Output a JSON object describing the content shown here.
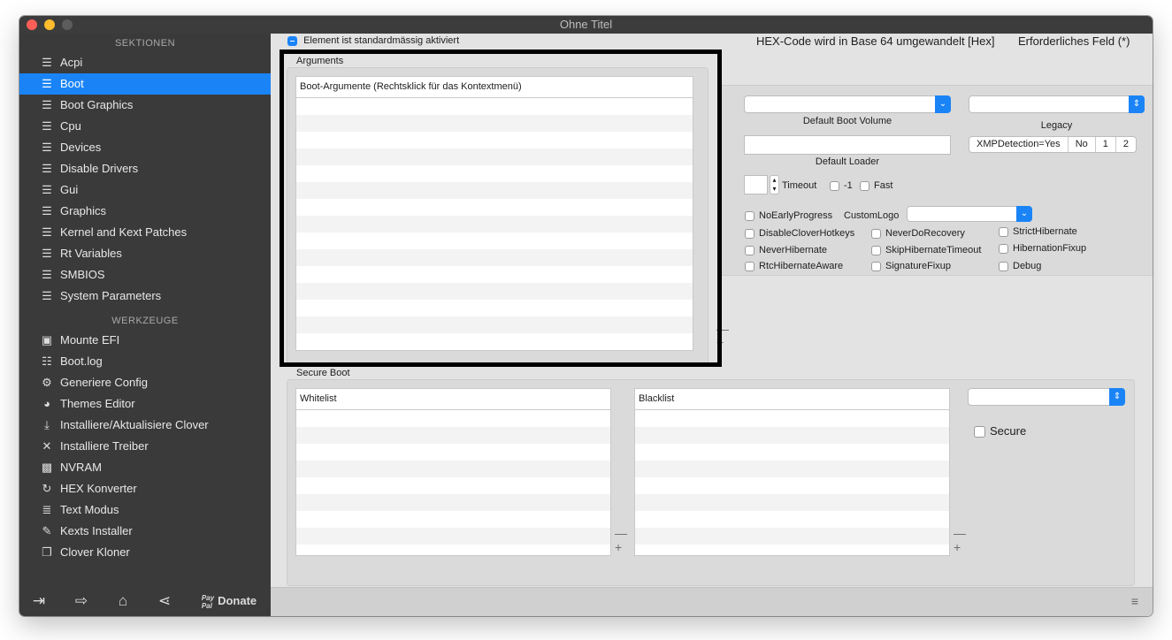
{
  "window": {
    "title": "Ohne Titel"
  },
  "sidebar": {
    "sections_header": "SEKTIONEN",
    "sections": [
      {
        "label": "Acpi",
        "icon": "list-icon"
      },
      {
        "label": "Boot",
        "icon": "list-icon",
        "selected": true
      },
      {
        "label": "Boot Graphics",
        "icon": "list-icon"
      },
      {
        "label": "Cpu",
        "icon": "list-icon"
      },
      {
        "label": "Devices",
        "icon": "list-icon"
      },
      {
        "label": "Disable Drivers",
        "icon": "list-icon"
      },
      {
        "label": "Gui",
        "icon": "list-icon"
      },
      {
        "label": "Graphics",
        "icon": "list-icon"
      },
      {
        "label": "Kernel and Kext Patches",
        "icon": "list-icon"
      },
      {
        "label": "Rt Variables",
        "icon": "list-icon"
      },
      {
        "label": "SMBIOS",
        "icon": "list-icon"
      },
      {
        "label": "System Parameters",
        "icon": "list-icon"
      }
    ],
    "tools_header": "WERKZEUGE",
    "tools": [
      {
        "label": "Mounte EFI",
        "icon": "disk-icon"
      },
      {
        "label": "Boot.log",
        "icon": "log-icon"
      },
      {
        "label": "Generiere Config",
        "icon": "gears-icon"
      },
      {
        "label": "Themes Editor",
        "icon": "palette-icon"
      },
      {
        "label": "Installiere/Aktualisiere Clover",
        "icon": "download-icon"
      },
      {
        "label": "Installiere Treiber",
        "icon": "tools-icon"
      },
      {
        "label": "NVRAM",
        "icon": "chip-icon"
      },
      {
        "label": "HEX Konverter",
        "icon": "refresh-icon"
      },
      {
        "label": "Text Modus",
        "icon": "text-icon"
      },
      {
        "label": "Kexts Installer",
        "icon": "plugin-icon"
      },
      {
        "label": "Clover Kloner",
        "icon": "copy-icon"
      }
    ],
    "bottom": {
      "paypal_top": "Pay",
      "paypal_bottom": "Pal",
      "donate": "Donate"
    }
  },
  "top": {
    "element_active_label": "Element ist standardmässig aktiviert",
    "hex_note": "HEX-Code wird in Base 64 umgewandelt [Hex]",
    "required_note": "Erforderliches Feld (*)"
  },
  "arguments": {
    "title": "Arguments",
    "column": "Boot-Argumente (Rechtsklick für das Kontextmenü)",
    "minus": "—",
    "plus": "+"
  },
  "boot_settings": {
    "default_boot_volume": "Default Boot Volume",
    "legacy": "Legacy",
    "default_loader": "Default Loader",
    "xmp": [
      "XMPDetection=Yes",
      "No",
      "1",
      "2"
    ],
    "timeout_label": "Timeout",
    "minus_one": "-1",
    "fast": "Fast",
    "custom_logo": "CustomLogo",
    "options": [
      "NoEarlyProgress",
      "DisableCloverHotkeys",
      "NeverDoRecovery",
      "StrictHibernate",
      "NeverHibernate",
      "SkipHibernateTimeout",
      "HibernationFixup",
      "RtcHibernateAware",
      "SignatureFixup",
      "Debug"
    ]
  },
  "secure_boot": {
    "title": "Secure Boot",
    "whitelist": "Whitelist",
    "blacklist": "Blacklist",
    "secure": "Secure",
    "minus": "—",
    "plus": "+"
  }
}
